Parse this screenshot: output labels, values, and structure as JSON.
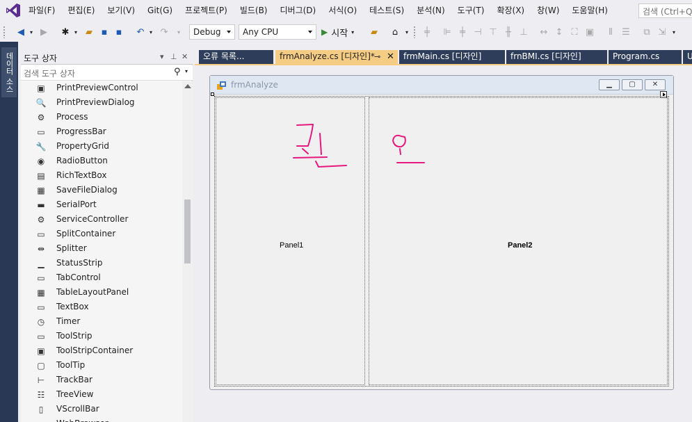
{
  "menu": [
    "파일(F)",
    "편집(E)",
    "보기(V)",
    "Git(G)",
    "프로젝트(P)",
    "빌드(B)",
    "디버그(D)",
    "서식(O)",
    "테스트(S)",
    "분석(N)",
    "도구(T)",
    "확장(X)",
    "창(W)",
    "도움말(H)"
  ],
  "global_search": "검색 (Ctrl+Q)",
  "toolbar": {
    "config": "Debug",
    "platform": "Any CPU",
    "start_label": "시작"
  },
  "side_tab": "데이터 소스",
  "toolbox": {
    "title": "도구 상자",
    "search_placeholder": "검색 도구 상자",
    "items": [
      {
        "label": "PrintPreviewControl",
        "icon": "▣"
      },
      {
        "label": "PrintPreviewDialog",
        "icon": "🔍"
      },
      {
        "label": "Process",
        "icon": "⚙"
      },
      {
        "label": "ProgressBar",
        "icon": "▭"
      },
      {
        "label": "PropertyGrid",
        "icon": "🔧"
      },
      {
        "label": "RadioButton",
        "icon": "◉"
      },
      {
        "label": "RichTextBox",
        "icon": "▤"
      },
      {
        "label": "SaveFileDialog",
        "icon": "▦"
      },
      {
        "label": "SerialPort",
        "icon": "▬"
      },
      {
        "label": "ServiceController",
        "icon": "⚙"
      },
      {
        "label": "SplitContainer",
        "icon": "▭"
      },
      {
        "label": "Splitter",
        "icon": "⇹"
      },
      {
        "label": "StatusStrip",
        "icon": "▁"
      },
      {
        "label": "TabControl",
        "icon": "▭"
      },
      {
        "label": "TableLayoutPanel",
        "icon": "▦"
      },
      {
        "label": "TextBox",
        "icon": "▭"
      },
      {
        "label": "Timer",
        "icon": "◷"
      },
      {
        "label": "ToolStrip",
        "icon": "▭"
      },
      {
        "label": "ToolStripContainer",
        "icon": "▣"
      },
      {
        "label": "ToolTip",
        "icon": "▢"
      },
      {
        "label": "TrackBar",
        "icon": "⊢"
      },
      {
        "label": "TreeView",
        "icon": "☷"
      },
      {
        "label": "VScrollBar",
        "icon": "▯"
      },
      {
        "label": "WebBrowser",
        "icon": "▭"
      }
    ]
  },
  "tabs": [
    {
      "label": "오류 목록..."
    },
    {
      "label": "frmAnalyze.cs [디자인]*",
      "active": true
    },
    {
      "label": "frmMain.cs [디자인]"
    },
    {
      "label": "frnBMI.cs [디자인]"
    },
    {
      "label": "Program.cs"
    },
    {
      "label": "U"
    }
  ],
  "form": {
    "title": "frmAnalyze",
    "panel1_label": "Panel1",
    "panel2_label": "Panel2",
    "annotation_color": "#e6197e"
  },
  "colors": {
    "active_tab": "#f5cc84",
    "inactive_tab": "#2e3d5a",
    "side_strip": "#293955"
  }
}
